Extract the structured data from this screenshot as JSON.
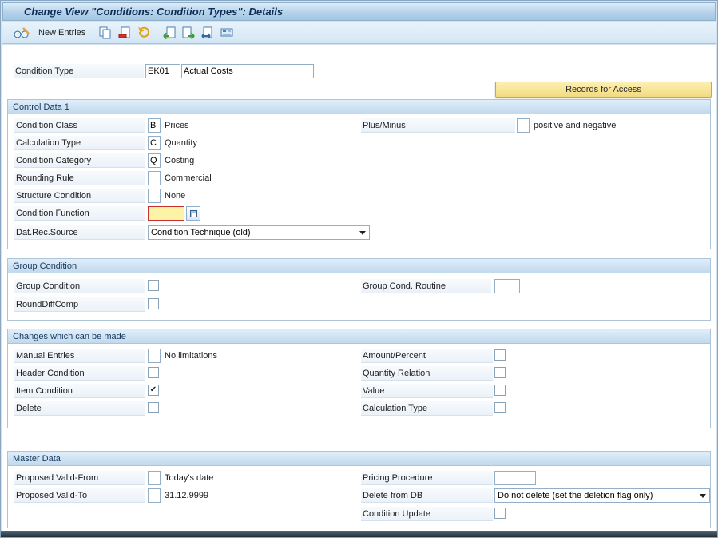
{
  "titlebar": {
    "title": "Change View \"Conditions: Condition Types\": Details"
  },
  "toolbar": {
    "new_entries_label": "New Entries",
    "icons": {
      "display_change": "display-change-icon",
      "copy_entry": "copy-entry-icon",
      "delete_entry": "delete-entry-icon",
      "undo": "undo-icon",
      "previous_entry": "previous-entry-icon",
      "next_entry": "next-entry-icon",
      "other_entry": "other-entry-icon",
      "bc_set": "bc-set-icon",
      "possible_entries": "possible-entries-icon",
      "dropdown_arrow": "dropdown-arrow-icon"
    }
  },
  "header": {
    "condition_type_label": "Condition Type",
    "condition_type_key": "EK01",
    "condition_type_name": "Actual Costs",
    "records_for_access_button": "Records for Access"
  },
  "control_data": {
    "section_title": "Control Data 1",
    "condition_class": {
      "label": "Condition Class",
      "value": "B",
      "text": "Prices"
    },
    "plus_minus": {
      "label": "Plus/Minus",
      "value": "",
      "text": "positive and negative"
    },
    "calculation_type": {
      "label": "Calculation Type",
      "value": "C",
      "text": "Quantity"
    },
    "condition_category": {
      "label": "Condition Category",
      "value": "Q",
      "text": "Costing"
    },
    "rounding_rule": {
      "label": "Rounding Rule",
      "value": "",
      "text": "Commercial"
    },
    "structure_condition": {
      "label": "Structure Condition",
      "value": "",
      "text": "None"
    },
    "condition_function": {
      "label": "Condition Function",
      "value": ""
    },
    "dat_rec_source": {
      "label": "Dat.Rec.Source",
      "value": "Condition Technique (old)"
    }
  },
  "group_condition": {
    "section_title": "Group Condition",
    "group_condition": {
      "label": "Group Condition",
      "checked": false
    },
    "group_cond_routine": {
      "label": "Group Cond. Routine",
      "value": ""
    },
    "round_diff_comp": {
      "label": "RoundDiffComp",
      "checked": false
    }
  },
  "changes": {
    "section_title": "Changes which can be made",
    "manual_entries": {
      "label": "Manual Entries",
      "value": "",
      "text": "No limitations"
    },
    "amount_percent": {
      "label": "Amount/Percent",
      "checked": false
    },
    "header_condition": {
      "label": "Header Condition",
      "checked": false
    },
    "quantity_relation": {
      "label": "Quantity Relation",
      "checked": false
    },
    "item_condition": {
      "label": "Item Condition",
      "checked": true,
      "check_glyph": "✔"
    },
    "value": {
      "label": "Value",
      "checked": false
    },
    "delete": {
      "label": "Delete",
      "checked": false
    },
    "calculation_type": {
      "label": "Calculation Type",
      "checked": false
    }
  },
  "master_data": {
    "section_title": "Master Data",
    "proposed_valid_from": {
      "label": "Proposed Valid-From",
      "value": "",
      "text": "Today's date"
    },
    "pricing_procedure": {
      "label": "Pricing Procedure",
      "value": ""
    },
    "proposed_valid_to": {
      "label": "Proposed Valid-To",
      "value": "",
      "text": "31.12.9999"
    },
    "delete_from_db": {
      "label": "Delete from DB",
      "value": "Do not delete (set the deletion flag only)"
    },
    "condition_update": {
      "label": "Condition Update",
      "checked": false
    }
  },
  "colors": {
    "titlebar_blue": "#a9c9e4",
    "section_header_blue": "#cfe2f3",
    "records_button_yellow": "#f2da7f",
    "required_field_yellow": "#fcf3a6",
    "selection_red": "#c9302c"
  }
}
